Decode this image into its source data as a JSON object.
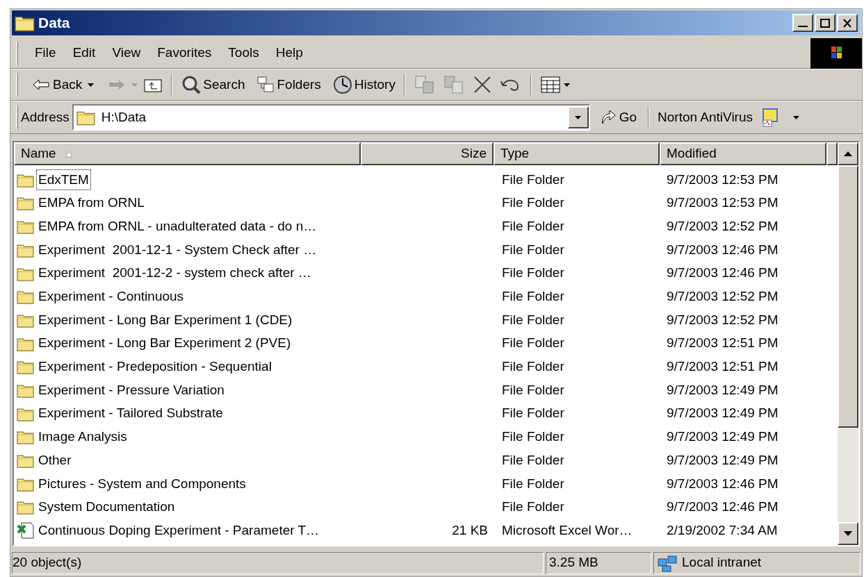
{
  "window": {
    "title": "Data"
  },
  "menu": [
    "File",
    "Edit",
    "View",
    "Favorites",
    "Tools",
    "Help"
  ],
  "toolbar": {
    "back": "Back",
    "search": "Search",
    "folders": "Folders",
    "history": "History"
  },
  "address": {
    "label": "Address",
    "value": "H:\\Data",
    "go": "Go",
    "norton": "Norton AntiVirus"
  },
  "table": {
    "columns": [
      "Name",
      "Size",
      "Type",
      "Modified"
    ],
    "rows": [
      {
        "kind": "folder",
        "name": "EdxTEM",
        "size": "",
        "type": "File Folder",
        "modified": "9/7/2003 12:53 PM",
        "focused": true
      },
      {
        "kind": "folder",
        "name": "EMPA from ORNL",
        "size": "",
        "type": "File Folder",
        "modified": "9/7/2003 12:53 PM",
        "focused": false
      },
      {
        "kind": "folder",
        "name": "EMPA from ORNL - unadulterated data - do n…",
        "size": "",
        "type": "File Folder",
        "modified": "9/7/2003 12:52 PM",
        "focused": false
      },
      {
        "kind": "folder",
        "name": "Experiment  2001-12-1 - System Check after …",
        "size": "",
        "type": "File Folder",
        "modified": "9/7/2003 12:46 PM",
        "focused": false
      },
      {
        "kind": "folder",
        "name": "Experiment  2001-12-2 - system check after …",
        "size": "",
        "type": "File Folder",
        "modified": "9/7/2003 12:46 PM",
        "focused": false
      },
      {
        "kind": "folder",
        "name": "Experiment - Continuous",
        "size": "",
        "type": "File Folder",
        "modified": "9/7/2003 12:52 PM",
        "focused": false
      },
      {
        "kind": "folder",
        "name": "Experiment - Long Bar Experiment 1 (CDE)",
        "size": "",
        "type": "File Folder",
        "modified": "9/7/2003 12:52 PM",
        "focused": false
      },
      {
        "kind": "folder",
        "name": "Experiment - Long Bar Experiment 2 (PVE)",
        "size": "",
        "type": "File Folder",
        "modified": "9/7/2003 12:51 PM",
        "focused": false
      },
      {
        "kind": "folder",
        "name": "Experiment - Predeposition - Sequential",
        "size": "",
        "type": "File Folder",
        "modified": "9/7/2003 12:51 PM",
        "focused": false
      },
      {
        "kind": "folder",
        "name": "Experiment - Pressure Variation",
        "size": "",
        "type": "File Folder",
        "modified": "9/7/2003 12:49 PM",
        "focused": false
      },
      {
        "kind": "folder",
        "name": "Experiment - Tailored Substrate",
        "size": "",
        "type": "File Folder",
        "modified": "9/7/2003 12:49 PM",
        "focused": false
      },
      {
        "kind": "folder",
        "name": "Image Analysis",
        "size": "",
        "type": "File Folder",
        "modified": "9/7/2003 12:49 PM",
        "focused": false
      },
      {
        "kind": "folder",
        "name": "Other",
        "size": "",
        "type": "File Folder",
        "modified": "9/7/2003 12:49 PM",
        "focused": false
      },
      {
        "kind": "folder",
        "name": "Pictures - System and Components",
        "size": "",
        "type": "File Folder",
        "modified": "9/7/2003 12:46 PM",
        "focused": false
      },
      {
        "kind": "folder",
        "name": "System Documentation",
        "size": "",
        "type": "File Folder",
        "modified": "9/7/2003 12:46 PM",
        "focused": false
      },
      {
        "kind": "excel",
        "name": "Continuous Doping Experiment - Parameter T…",
        "size": "21 KB",
        "type": "Microsoft Excel Wor…",
        "modified": "2/19/2002 7:34 AM",
        "focused": false
      }
    ]
  },
  "status_bar": {
    "objects": "20 object(s)",
    "size": "3.25 MB",
    "zone": "Local intranet"
  }
}
